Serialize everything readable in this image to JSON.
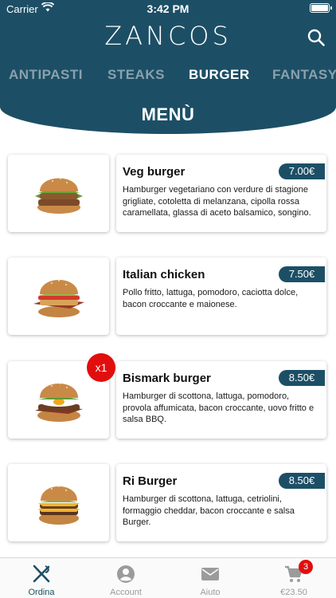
{
  "status_bar": {
    "carrier": "Carrier",
    "time": "3:42 PM"
  },
  "header": {
    "logo": "ZANCOS",
    "tabs": [
      {
        "label": "ANTIPASTI",
        "active": false
      },
      {
        "label": "STEAKS",
        "active": false
      },
      {
        "label": "BURGER",
        "active": true
      },
      {
        "label": "FANTASY",
        "active": false
      }
    ],
    "section_title": "MENÙ"
  },
  "products": [
    {
      "name": "Veg burger",
      "price": "7.00€",
      "description": "Hamburger vegetariano con verdure di stagione grigliate, cotoletta di melanzana, cipolla rossa caramellata, glassa di aceto balsamico, songino.",
      "image": "veg-burger-image"
    },
    {
      "name": "Italian chicken",
      "price": "7.50€",
      "description": "Pollo fritto, lattuga, pomodoro, caciotta dolce, bacon croccante e maionese.",
      "image": "chicken-burger-image"
    },
    {
      "name": "Bismark burger",
      "price": "8.50€",
      "description": "Hamburger di scottona, lattuga, pomodoro, provola affumicata, bacon croccante, uovo fritto e salsa BBQ.",
      "image": "bismark-burger-image",
      "quantity": "x1"
    },
    {
      "name": "Ri Burger",
      "price": "8.50€",
      "description": "Hamburger di scottona, lattuga, cetriolini, formaggio cheddar, bacon croccante e salsa Burger.",
      "image": "ri-burger-image"
    }
  ],
  "tab_bar": {
    "items": [
      {
        "label": "Ordina",
        "icon": "fork-knife-icon",
        "active": true
      },
      {
        "label": "Account",
        "icon": "account-icon",
        "active": false
      },
      {
        "label": "Aiuto",
        "icon": "mail-icon",
        "active": false
      },
      {
        "label": "€23.50",
        "icon": "cart-icon",
        "active": false,
        "badge": "3"
      }
    ]
  },
  "colors": {
    "primary": "#1c4f66",
    "badge": "#e10e0e",
    "inactive_tab": "#8aa1ad",
    "tabbar_inactive": "#9b9b9b"
  }
}
